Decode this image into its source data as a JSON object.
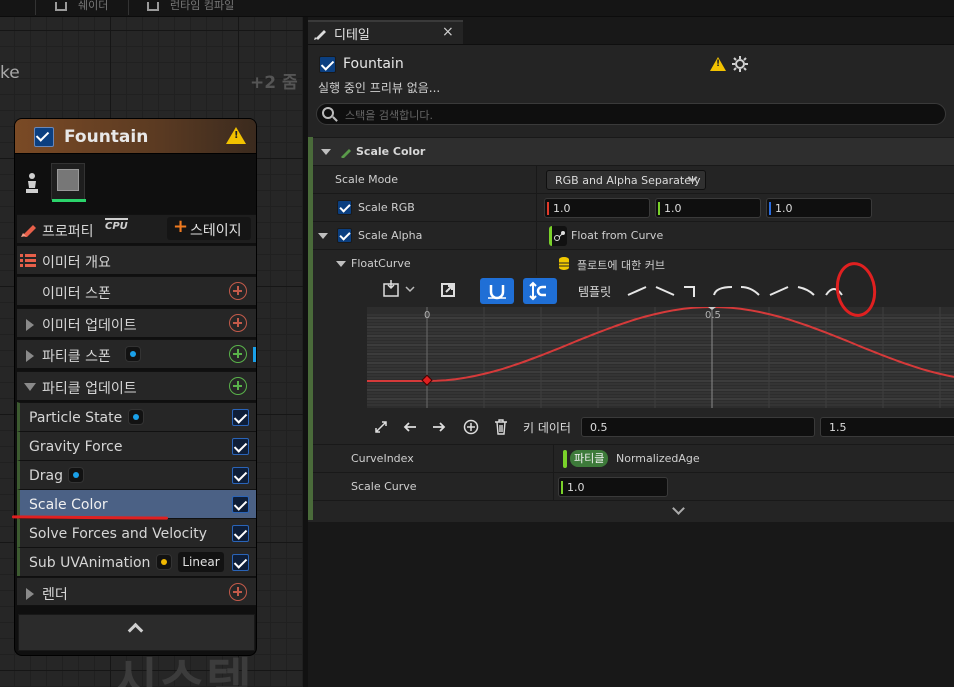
{
  "toolbar": {
    "label1": "쉐이더",
    "label2": "런타임 컴파일"
  },
  "graph": {
    "left_text": "ke",
    "zoom": "+2 줌",
    "watermark": "시스템"
  },
  "node": {
    "title": "Fountain",
    "properties_label": "프로퍼티",
    "cpu_label": "CPU",
    "stage_label": "스테이지",
    "emitter_summary": "이미터 개요",
    "emitter_spawn": "이미터 스폰",
    "emitter_update": "이미터 업데이트",
    "particle_spawn": "파티클 스폰",
    "particle_update": "파티클 업데이트",
    "modules": [
      {
        "label": "Particle State",
        "dot": true
      },
      {
        "label": "Gravity Force",
        "dot": false
      },
      {
        "label": "Drag",
        "dot": true
      },
      {
        "label": "Scale Color",
        "dot": false
      },
      {
        "label": "Solve Forces and Velocity",
        "dot": false
      },
      {
        "label": "Sub UVAnimation",
        "dot": true,
        "badge": "Linear"
      }
    ],
    "render": "렌더"
  },
  "details": {
    "tab_title": "디테일",
    "close": "×",
    "object_name": "Fountain",
    "preview_status": "실행 중인 프리뷰 없음...",
    "search_placeholder": "스택을 검색합니다.",
    "section_title": "Scale Color",
    "rows": {
      "scale_mode_label": "Scale Mode",
      "scale_mode_value": "RGB and Alpha Separately",
      "scale_rgb_label": "Scale RGB",
      "rgb_values": [
        "1.0",
        "1.0",
        "1.0"
      ],
      "scale_alpha_label": "Scale Alpha",
      "scale_alpha_value": "Float from Curve",
      "float_curve_label": "FloatCurve",
      "float_curve_value": "플로트에 대한 커브",
      "template_label": "템플릿",
      "axis_x0": "0",
      "axis_x05": "0.5",
      "key_data_label": "키 데이터",
      "key_time": "0.5",
      "key_value": "1.5",
      "curve_index_label": "CurveIndex",
      "curve_index_badge": "파티클",
      "curve_index_value": "NormalizedAge",
      "scale_curve_label": "Scale Curve",
      "scale_curve_value": "1.0"
    },
    "rgb_colors": [
      "#e03a2a",
      "#7ad12a",
      "#2a6de0"
    ]
  },
  "colors": {
    "accent": "#1f6fd6",
    "selected": "#4b6185",
    "annotation": "#e02020",
    "curve": "#d53a3a"
  },
  "curve_data": {
    "x": [
      -0.1,
      0,
      0.25,
      0.5,
      0.75,
      1.0
    ],
    "y": [
      0.0,
      0.0,
      0.5,
      1.0,
      0.5,
      0.0
    ]
  }
}
